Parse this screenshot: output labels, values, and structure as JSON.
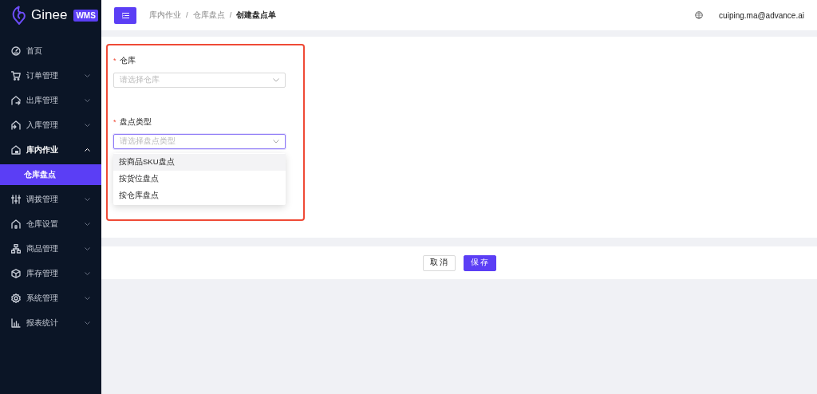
{
  "sidebar": {
    "logo": "Ginee",
    "badge": "WMS",
    "items": [
      {
        "label": "首页",
        "kind": "link"
      },
      {
        "label": "订单管理",
        "kind": "group",
        "expanded": false
      },
      {
        "label": "出库管理",
        "kind": "group",
        "expanded": false
      },
      {
        "label": "入库管理",
        "kind": "group",
        "expanded": false
      },
      {
        "label": "库内作业",
        "kind": "group",
        "expanded": true,
        "children": [
          {
            "label": "仓库盘点",
            "selected": true
          }
        ]
      },
      {
        "label": "调拨管理",
        "kind": "group",
        "expanded": false
      },
      {
        "label": "仓库设置",
        "kind": "group",
        "expanded": false
      },
      {
        "label": "商品管理",
        "kind": "group",
        "expanded": false
      },
      {
        "label": "库存管理",
        "kind": "group",
        "expanded": false
      },
      {
        "label": "系统管理",
        "kind": "group",
        "expanded": false
      },
      {
        "label": "报表统计",
        "kind": "group",
        "expanded": false
      }
    ]
  },
  "header": {
    "separator": "/",
    "breadcrumb": [
      "库内作业",
      "仓库盘点",
      "创建盘点单"
    ],
    "user": "cuiping.ma@advance.ai"
  },
  "form": {
    "fields": [
      {
        "label": "仓库",
        "required_mark": "*",
        "placeholder": "请选择仓库",
        "focused": false
      },
      {
        "label": "盘点类型",
        "required_mark": "*",
        "placeholder": "请选择盘点类型",
        "focused": true,
        "options": [
          {
            "label": "按商品SKU盘点",
            "highlighted": true
          },
          {
            "label": "按货位盘点",
            "highlighted": false
          },
          {
            "label": "按仓库盘点",
            "highlighted": false
          }
        ]
      }
    ]
  },
  "footer": {
    "buttons": [
      {
        "label": "取消",
        "kind": "secondary"
      },
      {
        "label": "保存",
        "kind": "primary"
      }
    ]
  }
}
